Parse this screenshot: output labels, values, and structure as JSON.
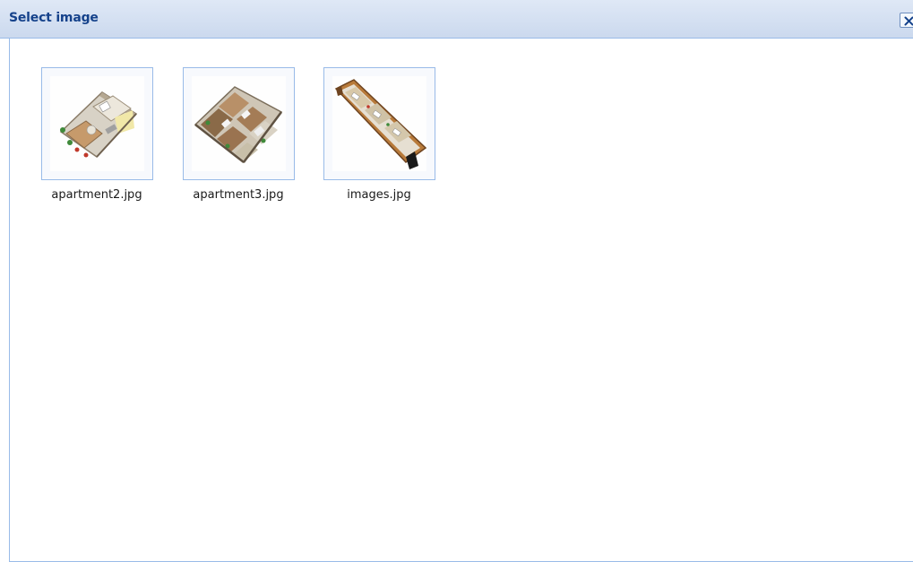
{
  "dialog": {
    "title": "Select image",
    "close_icon": "close-icon"
  },
  "images": [
    {
      "filename": "apartment2.jpg",
      "icon": "floorplan-thumbnail"
    },
    {
      "filename": "apartment3.jpg",
      "icon": "floorplan-thumbnail"
    },
    {
      "filename": "images.jpg",
      "icon": "floorplan-thumbnail"
    }
  ],
  "colors": {
    "title_text": "#15428b",
    "titlebar_bg": "#cbd9ee",
    "border": "#99bbe8"
  }
}
